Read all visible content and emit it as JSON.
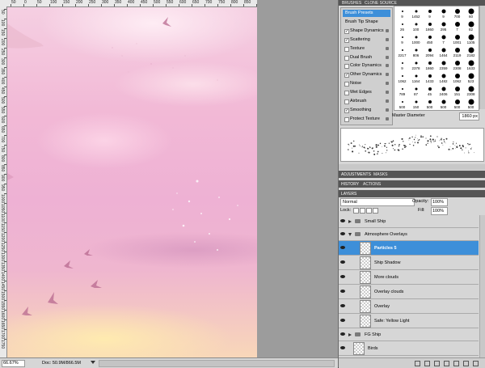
{
  "ruler": {
    "top_labels": [
      "50",
      "0",
      "50",
      "100",
      "150",
      "200",
      "250",
      "300",
      "350",
      "400",
      "450",
      "500",
      "550",
      "600",
      "650",
      "700",
      "750",
      "800",
      "850",
      "900"
    ],
    "left_labels": [
      "50",
      "100",
      "150",
      "200",
      "250",
      "300",
      "350",
      "400",
      "450",
      "500",
      "550",
      "600",
      "650",
      "700",
      "750",
      "800",
      "850",
      "900",
      "950",
      "1000",
      "1050",
      "1100",
      "1150",
      "1200",
      "1250",
      "1300",
      "1350",
      "1400",
      "1450",
      "1500",
      "1550",
      "1600",
      "1650",
      "1700",
      "1750"
    ]
  },
  "status": {
    "zoom": "66.67%",
    "doc": "Doc: 50.9M/866.5M"
  },
  "brushes_panel": {
    "tabs": [
      "BRUSHES",
      "CLONE SOURCE"
    ],
    "options": [
      {
        "label": "Brush Presets",
        "checkbox": false,
        "checked": false,
        "lock": false
      },
      {
        "label": "Brush Tip Shape",
        "checkbox": false,
        "checked": false,
        "lock": false
      },
      {
        "label": "Shape Dynamics",
        "checkbox": true,
        "checked": true,
        "lock": true
      },
      {
        "label": "Scattering",
        "checkbox": true,
        "checked": true,
        "lock": true
      },
      {
        "label": "Texture",
        "checkbox": true,
        "checked": false,
        "lock": true
      },
      {
        "label": "Dual Brush",
        "checkbox": true,
        "checked": false,
        "lock": true
      },
      {
        "label": "Color Dynamics",
        "checkbox": true,
        "checked": false,
        "lock": true
      },
      {
        "label": "Other Dynamics",
        "checkbox": true,
        "checked": true,
        "lock": true
      },
      {
        "label": "Noise",
        "checkbox": true,
        "checked": false,
        "lock": true
      },
      {
        "label": "Wet Edges",
        "checkbox": true,
        "checked": false,
        "lock": true
      },
      {
        "label": "Airbrush",
        "checkbox": true,
        "checked": false,
        "lock": true
      },
      {
        "label": "Smoothing",
        "checkbox": true,
        "checked": true,
        "lock": true
      },
      {
        "label": "Protect Texture",
        "checkbox": true,
        "checked": false,
        "lock": true
      }
    ],
    "presets": [
      [
        "9",
        "1452",
        "9",
        "9",
        "700",
        "60"
      ],
      [
        "26",
        "100",
        "1860",
        "295",
        "7",
        "82"
      ],
      [
        "9",
        "1000",
        "450",
        "7",
        "1001",
        "1105"
      ],
      [
        "2217",
        "806",
        "2094",
        "1464",
        "2119",
        "2182"
      ],
      [
        "9",
        "2378",
        "1860",
        "2359",
        "2308",
        "1633"
      ],
      [
        "1062",
        "1164",
        "1433",
        "1482",
        "1062",
        "523"
      ],
      [
        "789",
        "87",
        "45",
        "2406",
        "151",
        "2308"
      ],
      [
        "500",
        "150",
        "500",
        "500",
        "500",
        "500"
      ]
    ],
    "master_diameter_label": "Master Diameter",
    "master_diameter_value": "1860 px"
  },
  "panel_tabs": {
    "adjustments": [
      "ADJUSTMENTS",
      "MASKS"
    ],
    "history": [
      "HISTORY",
      "ACTIONS"
    ],
    "layers_title": "LAYERS"
  },
  "layers_panel": {
    "blend_mode": "Normal",
    "opacity_label": "Opacity:",
    "opacity": "100%",
    "lock_label": "Lock:",
    "fill_label": "Fill:",
    "fill": "100%",
    "layers": [
      {
        "name": "Small Ship",
        "type": "group",
        "expanded": false,
        "indent": 0,
        "selected": false
      },
      {
        "name": "Atmosphere Overlays",
        "type": "group",
        "expanded": true,
        "indent": 0,
        "selected": false
      },
      {
        "name": "Particles 5",
        "type": "layer",
        "indent": 1,
        "selected": true
      },
      {
        "name": "Ship Shadow",
        "type": "layer",
        "indent": 1,
        "selected": false
      },
      {
        "name": "More clouds",
        "type": "layer",
        "indent": 1,
        "selected": false
      },
      {
        "name": "Overlay clouds",
        "type": "layer",
        "indent": 1,
        "selected": false
      },
      {
        "name": "Overlay",
        "type": "layer",
        "indent": 1,
        "selected": false
      },
      {
        "name": "Safe: Yellow Light",
        "type": "layer",
        "indent": 1,
        "selected": false
      },
      {
        "name": "FG Ship",
        "type": "group",
        "expanded": false,
        "indent": 0,
        "selected": false
      },
      {
        "name": "Birds",
        "type": "layer",
        "indent": 0,
        "selected": false
      }
    ]
  },
  "colors": {
    "selection": "#3d8fd9",
    "panel_bg": "#d6d6d6",
    "canvas_pink": "#f2b9d6",
    "canvas_yellow": "#f8d7b9"
  }
}
